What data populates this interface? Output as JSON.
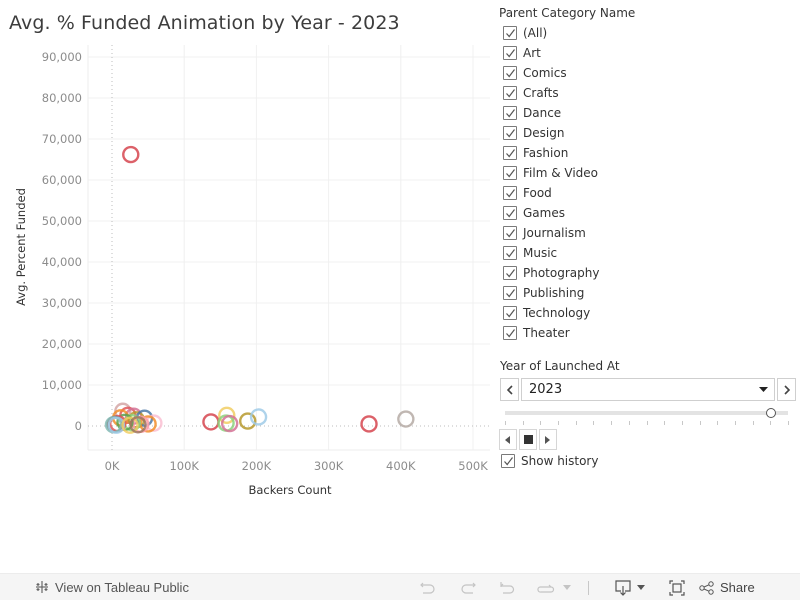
{
  "title": "Avg. % Funded Animation by Year - 2023",
  "chart_data": {
    "type": "scatter",
    "title": "Avg. % Funded Animation by Year - 2023",
    "xlabel": "Backers Count",
    "ylabel": "Avg. Percent Funded",
    "xlim": [
      -25000,
      505000
    ],
    "ylim": [
      -5000,
      92000
    ],
    "x_ticks": [
      0,
      100000,
      200000,
      300000,
      400000,
      500000
    ],
    "x_tick_labels": [
      "0K",
      "100K",
      "200K",
      "300K",
      "400K",
      "500K"
    ],
    "y_ticks": [
      0,
      10000,
      20000,
      30000,
      40000,
      50000,
      60000,
      70000,
      80000,
      90000
    ],
    "y_tick_labels": [
      "0",
      "10,000",
      "20,000",
      "30,000",
      "40,000",
      "50,000",
      "60,000",
      "70,000",
      "80,000",
      "90,000"
    ],
    "grid": true,
    "marker": "open-circle",
    "points": [
      {
        "x": 26000,
        "y": 66200,
        "color": "#d6454f"
      },
      {
        "x": 356000,
        "y": 500,
        "color": "#d6454f"
      },
      {
        "x": 407000,
        "y": 1700,
        "color": "#b5aaa5"
      },
      {
        "x": 137000,
        "y": 1000,
        "color": "#d6454f"
      },
      {
        "x": 159000,
        "y": 2600,
        "color": "#f1ce63"
      },
      {
        "x": 158000,
        "y": 700,
        "color": "#8cd17d"
      },
      {
        "x": 163000,
        "y": 600,
        "color": "#d37295"
      },
      {
        "x": 188000,
        "y": 1200,
        "color": "#b6992d"
      },
      {
        "x": 203000,
        "y": 2200,
        "color": "#a0cbe8"
      },
      {
        "x": 15000,
        "y": 3600,
        "color": "#d4a6a6"
      },
      {
        "x": 22000,
        "y": 2600,
        "color": "#e15759"
      },
      {
        "x": 30000,
        "y": 2400,
        "color": "#d37295"
      },
      {
        "x": 12000,
        "y": 2000,
        "color": "#f28e2b"
      },
      {
        "x": 34000,
        "y": 1500,
        "color": "#b6992d"
      },
      {
        "x": 45000,
        "y": 1900,
        "color": "#4e79a7"
      },
      {
        "x": 58000,
        "y": 700,
        "color": "#fabfd2"
      },
      {
        "x": 50000,
        "y": 500,
        "color": "#f28e2b"
      },
      {
        "x": 40000,
        "y": 400,
        "color": "#ff9da7"
      },
      {
        "x": 28000,
        "y": 800,
        "color": "#8cd17d"
      },
      {
        "x": 18000,
        "y": 900,
        "color": "#59a14f"
      },
      {
        "x": 8000,
        "y": 600,
        "color": "#e15759"
      },
      {
        "x": 4000,
        "y": 400,
        "color": "#79706e"
      },
      {
        "x": 2000,
        "y": 300,
        "color": "#86bcb6"
      },
      {
        "x": 6000,
        "y": 200,
        "color": "#a0cbe8"
      },
      {
        "x": 25000,
        "y": 200,
        "color": "#f1ce63"
      },
      {
        "x": 36000,
        "y": 300,
        "color": "#9d7660"
      }
    ]
  },
  "filter": {
    "title": "Parent Category Name",
    "items": [
      {
        "label": "(All)",
        "checked": true
      },
      {
        "label": "Art",
        "checked": true
      },
      {
        "label": "Comics",
        "checked": true
      },
      {
        "label": "Crafts",
        "checked": true
      },
      {
        "label": "Dance",
        "checked": true
      },
      {
        "label": "Design",
        "checked": true
      },
      {
        "label": "Fashion",
        "checked": true
      },
      {
        "label": "Film & Video",
        "checked": true
      },
      {
        "label": "Food",
        "checked": true
      },
      {
        "label": "Games",
        "checked": true
      },
      {
        "label": "Journalism",
        "checked": true
      },
      {
        "label": "Music",
        "checked": true
      },
      {
        "label": "Photography",
        "checked": true
      },
      {
        "label": "Publishing",
        "checked": true
      },
      {
        "label": "Technology",
        "checked": true
      },
      {
        "label": "Theater",
        "checked": true
      }
    ]
  },
  "year_filter": {
    "title": "Year of Launched At",
    "selected": "2023",
    "slider_position": 0.94,
    "slider_ticks": 17,
    "show_history_label": "Show history",
    "show_history_checked": true
  },
  "footer": {
    "view_label": "View on Tableau Public",
    "share_label": "Share"
  }
}
